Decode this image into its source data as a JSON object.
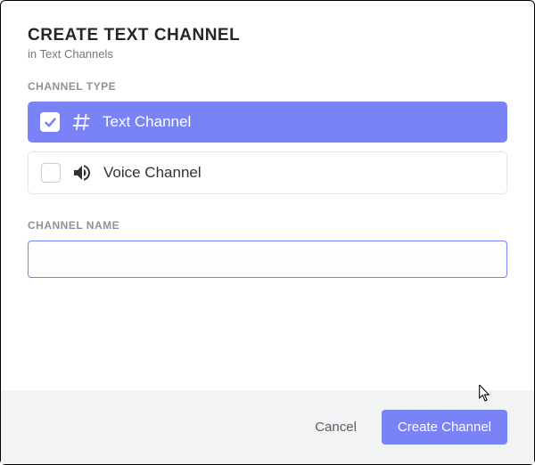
{
  "header": {
    "title": "CREATE TEXT CHANNEL",
    "subtitle": "in Text Channels"
  },
  "channelType": {
    "sectionLabel": "CHANNEL TYPE",
    "options": {
      "text": {
        "label": "Text Channel"
      },
      "voice": {
        "label": "Voice Channel"
      }
    }
  },
  "channelName": {
    "sectionLabel": "CHANNEL NAME",
    "value": ""
  },
  "footer": {
    "cancelLabel": "Cancel",
    "submitLabel": "Create Channel"
  }
}
